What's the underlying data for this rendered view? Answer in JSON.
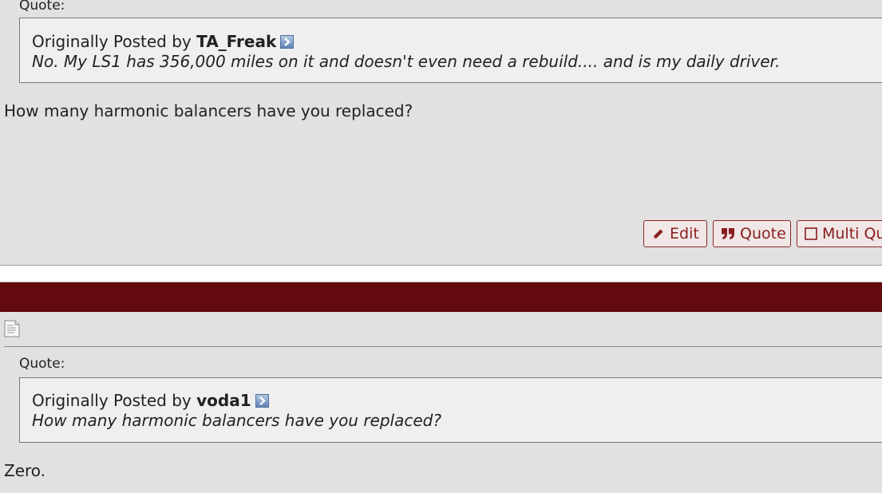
{
  "post1": {
    "quote_label": "Quote:",
    "quote": {
      "prefix": "Originally Posted by",
      "author": "TA_Freak",
      "text": "No. My LS1 has 356,000 miles on it and doesn't even need a rebuild.... and is my daily driver."
    },
    "message": "How many harmonic balancers have you replaced?",
    "buttons": {
      "edit": "Edit",
      "quote": "Quote",
      "multi_quote": "Multi Qu"
    }
  },
  "post2": {
    "quote_label": "Quote:",
    "quote": {
      "prefix": "Originally Posted by",
      "author": "voda1",
      "text": "How many harmonic balancers have you replaced?"
    },
    "message": "Zero."
  },
  "colors": {
    "background": "#e1e1e1",
    "header_bar": "#620a0d",
    "button_text": "#8a1c1c",
    "quote_bg": "#efefef"
  },
  "icons": [
    "view-post-icon",
    "pencil-icon",
    "quote-marks-icon",
    "checkbox-icon",
    "post-icon"
  ]
}
